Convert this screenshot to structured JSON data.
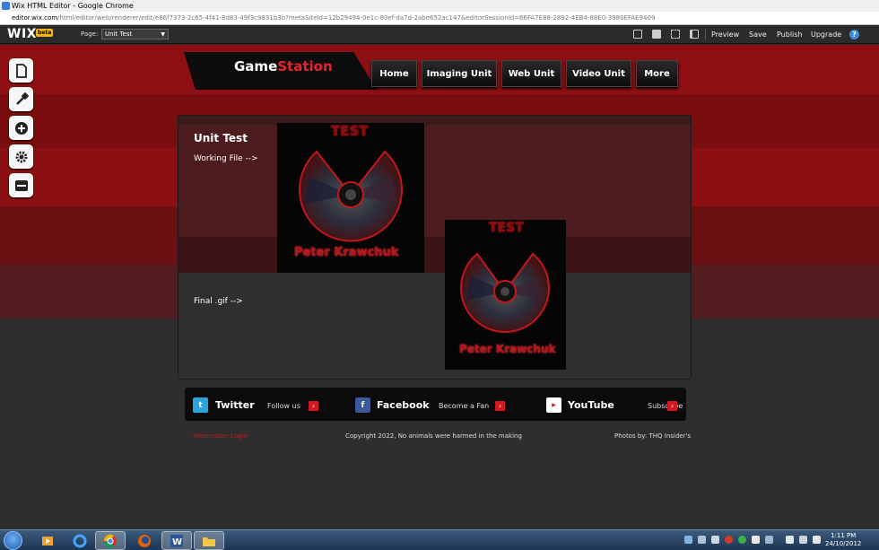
{
  "window": {
    "title": "Wix HTML Editor - Google Chrome"
  },
  "address": {
    "host": "editor.wix.com",
    "path": "/html/editor/web/renderer/edit/e86f7373-2c65-4f41-8d83-49f3c9831b3b?metaSiteId=12b29494-0e1c-80ef-da7d-2abe652ac147&editorSessionId=66FA7E88-2892-4EB4-88E0-3980EFAE9409"
  },
  "toolbar": {
    "logo": "WIX",
    "beta": "beta",
    "page_label": "Page:",
    "page_value": "Unit Test",
    "preview": "Preview",
    "save": "Save",
    "publish": "Publish",
    "upgrade": "Upgrade",
    "help": "?"
  },
  "sidebar": {
    "items": [
      {
        "name": "pages-icon"
      },
      {
        "name": "design-icon"
      },
      {
        "name": "add-icon"
      },
      {
        "name": "settings-icon"
      },
      {
        "name": "market-icon"
      }
    ]
  },
  "site": {
    "logo_part1": "Game",
    "logo_part2": "Station",
    "nav": [
      "Home",
      "Imaging Unit",
      "Web Unit",
      "Video Unit",
      "More"
    ],
    "content": {
      "title": "Unit Test",
      "working_file": "Working File -->",
      "final_gif": "Final .gif -->",
      "image_top_text": "TEST",
      "image_bottom_text": "Peter Krawchuk"
    },
    "social": {
      "twitter": {
        "name": "Twitter",
        "sub": "Follow us"
      },
      "facebook": {
        "name": "Facebook",
        "sub": "Become a Fan"
      },
      "youtube": {
        "name": "YouTube",
        "sub": "Subscribe"
      }
    },
    "footer": {
      "left": "Webmaster Login",
      "center": "Copyright 2022, No animals were harmed in the making",
      "right": "Photos by: THQ Insider's"
    }
  },
  "taskbar": {
    "time": "1:11 PM",
    "date": "24/10/2012"
  },
  "colors": {
    "accent_red": "#e8242a",
    "band_dark_red": "#7d0d10",
    "band_red": "#9c1115",
    "wix_dark": "#2b2b2b"
  }
}
